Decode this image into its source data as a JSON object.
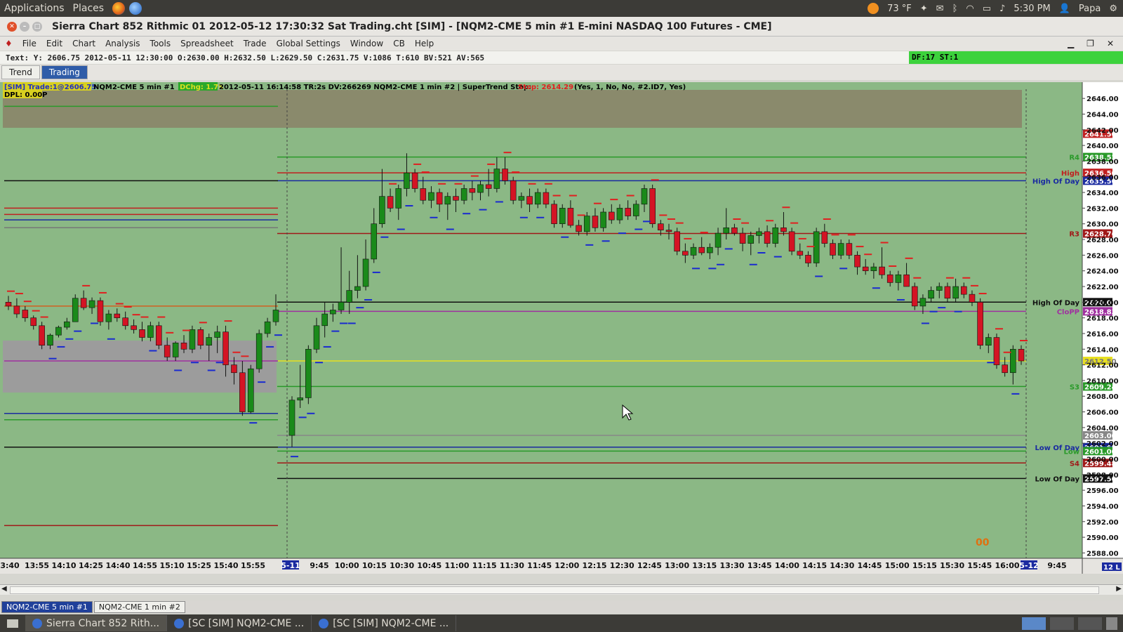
{
  "topbar": {
    "applications": "Applications",
    "places": "Places",
    "weather": "73 °F",
    "time": "5:30 PM",
    "user": "Papa"
  },
  "window": {
    "title": "Sierra Chart 852 Rithmic 01 2012-05-12  17:30:32 Sat  Trading.cht [SIM] - [NQM2-CME  5 min   #1  E-mini NASDAQ 100 Futures - CME]"
  },
  "menu": [
    "File",
    "Edit",
    "Chart",
    "Analysis",
    "Tools",
    "Spreadsheet",
    "Trade",
    "Global Settings",
    "Window",
    "CB",
    "Help"
  ],
  "infobar": {
    "text": "Text: Y: 2606.75  2012-05-11  12:30:00  O:2630.00  H:2632.50  L:2629.50  C:2631.75  V:1086  T:610  BV:521  AV:565",
    "df": "DF:17  ST:1"
  },
  "tabs": [
    "Trend",
    "Trading"
  ],
  "chart_header": {
    "sim_trade": "[SIM]  Trade:1@2606.75",
    "symbol1": "NQM2-CME  5 min   #1",
    "dchg": "DChg: 1.75",
    "line2": "2012-05-11  16:14:58  TR:2s  DV:266269  NQM2-CME  1 min   #2 | SuperTrend Stop:",
    "stop": "Stop: 2614.29",
    "params": "(Yes, 1, No, No, #2.ID7, Yes)",
    "dpl": "DPL: 0.00P"
  },
  "chart_data": {
    "type": "candlestick",
    "symbol": "NQM2-CME",
    "interval": "5 min",
    "y_axis_ticks": [
      "2646.00",
      "2644.00",
      "2642.00",
      "2640.00",
      "2638.00",
      "2636.00",
      "2634.00",
      "2632.00",
      "2630.00",
      "2628.00",
      "2626.00",
      "2624.00",
      "2622.00",
      "2620.00",
      "2618.00",
      "2616.00",
      "2614.00",
      "2612.00",
      "2610.00",
      "2608.00",
      "2606.00",
      "2604.00",
      "2602.00",
      "2600.00",
      "2598.00",
      "2596.00",
      "2594.00",
      "2592.00",
      "2590.00",
      "2588.00"
    ],
    "x_axis_ticks": [
      "3:40",
      "13:55",
      "14:10",
      "14:25",
      "14:40",
      "14:55",
      "15:10",
      "15:25",
      "15:40",
      "15:55",
      "5-11",
      "9:45",
      "10:00",
      "10:15",
      "10:30",
      "10:45",
      "11:00",
      "11:15",
      "11:30",
      "11:45",
      "12:00",
      "12:15",
      "12:30",
      "12:45",
      "13:00",
      "13:15",
      "13:30",
      "13:45",
      "14:00",
      "14:15",
      "14:30",
      "14:45",
      "15:00",
      "15:15",
      "15:30",
      "15:45",
      "16:00",
      "5-12",
      "9:45"
    ],
    "ylim": [
      2587.5,
      2647
    ],
    "levels": [
      {
        "label": "",
        "price": "2641.50",
        "value": 2641.5,
        "color": "#c02020"
      },
      {
        "label": "R4",
        "price": "2638.52",
        "value": 2638.52,
        "color": "#2a9a2a"
      },
      {
        "label": "High",
        "price": "2636.50",
        "value": 2636.5,
        "color": "#c02020"
      },
      {
        "label": "High Of Day",
        "price": "2635.50",
        "value": 2635.5,
        "color": "#1a2aa0"
      },
      {
        "label": "R3",
        "price": "2628.76",
        "value": 2628.76,
        "color": "#a01818"
      },
      {
        "label": "High Of Day",
        "price": "2620.00",
        "value": 2620.0,
        "color": "#111111"
      },
      {
        "label": "CloPP",
        "price": "2618.83",
        "value": 2618.83,
        "color": "#a030a0"
      },
      {
        "label": "",
        "price": "2612.50",
        "value": 2612.5,
        "color": "#e8e020"
      },
      {
        "label": "S3",
        "price": "2609.24",
        "value": 2609.24,
        "color": "#2a9a2a"
      },
      {
        "label": "",
        "price": "2603.00",
        "value": 2603.0,
        "color": "#888888"
      },
      {
        "label": "Low Of Day",
        "price": "2601.50",
        "value": 2601.5,
        "color": "#1a2aa0"
      },
      {
        "label": "Low",
        "price": "2601.00",
        "value": 2601.0,
        "color": "#2a9a2a"
      },
      {
        "label": "S4",
        "price": "2599.48",
        "value": 2599.48,
        "color": "#a01818"
      },
      {
        "label": "Low Of Day",
        "price": "2597.50",
        "value": 2597.5,
        "color": "#111111"
      }
    ],
    "candles": [
      [
        2620,
        2620.8,
        2619,
        2619.5
      ],
      [
        2619.5,
        2620.5,
        2618,
        2618.5
      ],
      [
        2619,
        2619.5,
        2617.5,
        2618
      ],
      [
        2618,
        2618.3,
        2616.5,
        2617
      ],
      [
        2617,
        2617.5,
        2614,
        2614.5
      ],
      [
        2614.5,
        2616,
        2614,
        2615.8
      ],
      [
        2615.8,
        2617,
        2615.5,
        2616.8
      ],
      [
        2616.8,
        2618,
        2616.5,
        2617.5
      ],
      [
        2617.5,
        2621,
        2617.5,
        2620.5
      ],
      [
        2620.5,
        2621.5,
        2619,
        2619.3
      ],
      [
        2619.3,
        2620.6,
        2618.5,
        2620.2
      ],
      [
        2620.2,
        2620.6,
        2617,
        2617.5
      ],
      [
        2617.5,
        2619,
        2616.5,
        2618.5
      ],
      [
        2618.5,
        2619.2,
        2617.5,
        2618
      ],
      [
        2618,
        2618.8,
        2616.5,
        2617
      ],
      [
        2617,
        2617.8,
        2616,
        2616.5
      ],
      [
        2616.5,
        2617.5,
        2615,
        2615.5
      ],
      [
        2615.5,
        2617.5,
        2615,
        2617
      ],
      [
        2617,
        2617.5,
        2614,
        2614.5
      ],
      [
        2614.5,
        2615.5,
        2612.5,
        2613
      ],
      [
        2613,
        2615,
        2612.5,
        2614.8
      ],
      [
        2614.8,
        2615.8,
        2613.5,
        2614
      ],
      [
        2614,
        2617,
        2613.5,
        2616.5
      ],
      [
        2616.5,
        2616.8,
        2614,
        2614.5
      ],
      [
        2614.5,
        2616,
        2612.5,
        2615.5
      ],
      [
        2615.5,
        2617,
        2613.5,
        2616.2
      ],
      [
        2616.2,
        2617,
        2610.5,
        2612
      ],
      [
        2612,
        2613,
        2609.5,
        2611
      ],
      [
        2611,
        2612.5,
        2605.5,
        2606
      ],
      [
        2606,
        2612,
        2605.8,
        2611.5
      ],
      [
        2611.5,
        2616.5,
        2611,
        2616
      ],
      [
        2616,
        2618,
        2615.5,
        2617.5
      ],
      [
        2617.5,
        2621,
        2617,
        2619
      ],
      [
        2603,
        2608,
        2601.5,
        2607.5
      ],
      [
        2607.5,
        2612,
        2606.5,
        2607.8
      ],
      [
        2607.8,
        2614.5,
        2607,
        2614
      ],
      [
        2614,
        2618,
        2613.5,
        2617
      ],
      [
        2617,
        2620,
        2615.5,
        2618.5
      ],
      [
        2618.5,
        2619.8,
        2617.5,
        2619
      ],
      [
        2619,
        2627,
        2618.5,
        2620
      ],
      [
        2620,
        2624,
        2618.5,
        2621.5
      ],
      [
        2621.5,
        2626,
        2620.5,
        2622
      ],
      [
        2622,
        2628,
        2621.5,
        2625.5
      ],
      [
        2625.5,
        2632,
        2625,
        2630
      ],
      [
        2630,
        2637,
        2629.5,
        2633.5
      ],
      [
        2633.5,
        2634.5,
        2631.5,
        2632
      ],
      [
        2632,
        2635,
        2630.5,
        2634.5
      ],
      [
        2634.5,
        2639,
        2633.5,
        2636.5
      ],
      [
        2636.5,
        2637,
        2634,
        2634.5
      ],
      [
        2634.5,
        2636,
        2632.5,
        2633
      ],
      [
        2633,
        2634.8,
        2632,
        2634
      ],
      [
        2634,
        2634.5,
        2631.5,
        2632.5
      ],
      [
        2632.5,
        2634,
        2630.5,
        2633.5
      ],
      [
        2633.5,
        2634.5,
        2631.5,
        2633
      ],
      [
        2633,
        2635,
        2632.5,
        2634.5
      ],
      [
        2634.5,
        2635.5,
        2633,
        2634
      ],
      [
        2634,
        2635.5,
        2633,
        2635
      ],
      [
        2635,
        2637,
        2633.5,
        2634.5
      ],
      [
        2634.5,
        2638.5,
        2634,
        2637
      ],
      [
        2637,
        2638.5,
        2635,
        2635.5
      ],
      [
        2635.5,
        2636,
        2632.5,
        2633
      ],
      [
        2633,
        2634,
        2632,
        2633.5
      ],
      [
        2633.5,
        2634.5,
        2631.5,
        2632.5
      ],
      [
        2632.5,
        2634.5,
        2632,
        2634
      ],
      [
        2634,
        2634.5,
        2632,
        2632.5
      ],
      [
        2632.5,
        2633,
        2629.5,
        2630
      ],
      [
        2630,
        2632.5,
        2629.5,
        2632
      ],
      [
        2632,
        2633,
        2629.5,
        2629.8
      ],
      [
        2629.8,
        2630.5,
        2628.5,
        2629
      ],
      [
        2629,
        2631.5,
        2628.5,
        2631
      ],
      [
        2631,
        2632,
        2629,
        2629.5
      ],
      [
        2629.5,
        2632,
        2629,
        2631.5
      ],
      [
        2631.5,
        2632.5,
        2630,
        2630.5
      ],
      [
        2630.5,
        2632.5,
        2630,
        2632
      ],
      [
        2632,
        2633,
        2630.5,
        2631
      ],
      [
        2631,
        2633,
        2630.5,
        2632.5
      ],
      [
        2632.5,
        2635,
        2631.5,
        2634.5
      ],
      [
        2634.5,
        2635,
        2629.5,
        2630
      ],
      [
        2630,
        2630.5,
        2628.5,
        2629.2
      ],
      [
        2629.2,
        2630,
        2628,
        2629
      ],
      [
        2629,
        2629.5,
        2626,
        2626.5
      ],
      [
        2626.5,
        2627.5,
        2625,
        2626
      ],
      [
        2626,
        2627.5,
        2625.5,
        2627
      ],
      [
        2627,
        2628.3,
        2626,
        2626.3
      ],
      [
        2626.3,
        2627.5,
        2625.5,
        2627
      ],
      [
        2627,
        2629.5,
        2626,
        2628.8
      ],
      [
        2628.8,
        2632,
        2628,
        2629.5
      ],
      [
        2629.5,
        2630,
        2628.5,
        2628.8
      ],
      [
        2628.8,
        2629.5,
        2626.5,
        2627.5
      ],
      [
        2627.5,
        2629,
        2626,
        2628.5
      ],
      [
        2628.5,
        2629.5,
        2627.5,
        2629
      ],
      [
        2629,
        2629.8,
        2627,
        2627.5
      ],
      [
        2627.5,
        2630,
        2627,
        2629.5
      ],
      [
        2629.5,
        2631.5,
        2628.5,
        2629
      ],
      [
        2629,
        2629.5,
        2626,
        2626.5
      ],
      [
        2626.5,
        2627.5,
        2625.5,
        2626
      ],
      [
        2626,
        2626.5,
        2624.5,
        2625
      ],
      [
        2625,
        2629.5,
        2624.5,
        2629
      ],
      [
        2629,
        2630,
        2627,
        2627.5
      ],
      [
        2627.5,
        2628,
        2625.5,
        2626
      ],
      [
        2626,
        2628,
        2625.5,
        2627.5
      ],
      [
        2627.5,
        2628,
        2625.5,
        2626
      ],
      [
        2626,
        2626.5,
        2623.5,
        2624.5
      ],
      [
        2624.5,
        2625.5,
        2623.5,
        2624
      ],
      [
        2624,
        2625,
        2623,
        2624.5
      ],
      [
        2624.5,
        2627,
        2623,
        2623.5
      ],
      [
        2623.5,
        2624,
        2622,
        2622.5
      ],
      [
        2622.5,
        2624,
        2621.5,
        2623.5
      ],
      [
        2623.5,
        2625,
        2622,
        2622
      ],
      [
        2622,
        2622.5,
        2619,
        2619.5
      ],
      [
        2619.5,
        2621,
        2618.5,
        2620.5
      ],
      [
        2620.5,
        2622,
        2620,
        2621.5
      ],
      [
        2621.5,
        2622.5,
        2620.5,
        2622
      ],
      [
        2622,
        2622.5,
        2620,
        2620.5
      ],
      [
        2620.5,
        2623,
        2620,
        2622
      ],
      [
        2622,
        2622.5,
        2620.5,
        2621
      ],
      [
        2621,
        2621.5,
        2619.5,
        2620
      ],
      [
        2620,
        2620.5,
        2614,
        2614.5
      ],
      [
        2614.5,
        2616,
        2613.5,
        2615.5
      ],
      [
        2615.5,
        2616,
        2611.5,
        2612
      ],
      [
        2612,
        2613,
        2610.5,
        2611
      ],
      [
        2611,
        2614.5,
        2609.5,
        2614
      ],
      [
        2614,
        2614.5,
        2612,
        2612.5
      ]
    ],
    "session_break_index": 33,
    "value_label": "00",
    "corner_label": "12 L"
  },
  "chart_tabs": [
    "NQM2-CME  5 min   #1",
    "NQM2-CME  1 min   #2"
  ],
  "taskbar": [
    "Sierra Chart 852 Rith...",
    "[SC [SIM] NQM2-CME ...",
    "[SC [SIM] NQM2-CME ..."
  ],
  "colors": {
    "chart_bg": "#8bb885",
    "up": "#1a8a1a",
    "down": "#d41424",
    "stop_up": "#1a2ad0",
    "stop_down": "#e02020"
  }
}
